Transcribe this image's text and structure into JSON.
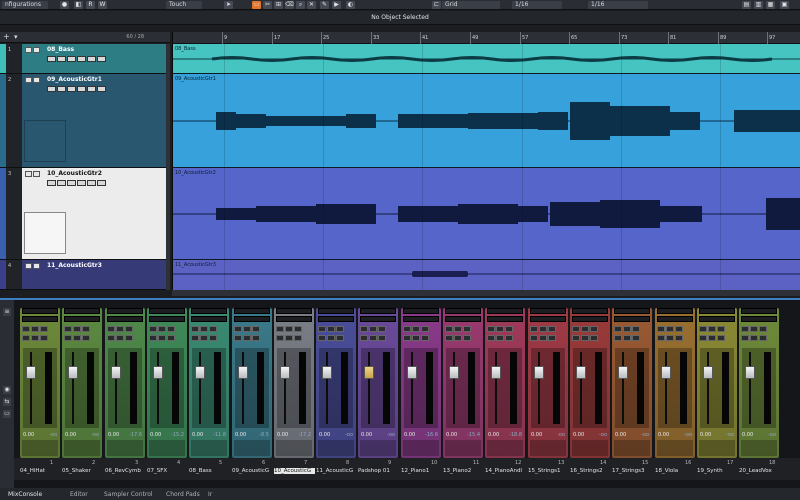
{
  "toolbar": {
    "left_label": "nfigurations",
    "mode_label": "Touch",
    "grid_label": "Grid",
    "quantize_label": "1/16",
    "selection_info": "No Object Selected"
  },
  "tracklist": {
    "count_label": "60 / 28",
    "tracks": [
      {
        "num": "1",
        "name": "08_Bass",
        "color": "#3fbfb8",
        "bg": "#2f7f86"
      },
      {
        "num": "2",
        "name": "09_AcousticGtr1",
        "color": "#2a6a8a",
        "bg": "#2b5b78"
      },
      {
        "num": "3",
        "name": "10_AcousticGtr2",
        "color": "#e8e8e8",
        "bg": "#e9e9e9"
      },
      {
        "num": "4",
        "name": "11_AcousticGtr3",
        "color": "#3b3f8a",
        "bg": "#3a3c7a"
      }
    ]
  },
  "ruler": {
    "ticks": [
      "9",
      "17",
      "25",
      "33",
      "41",
      "49",
      "57",
      "65",
      "73",
      "81",
      "89",
      "97"
    ]
  },
  "arrange": {
    "events": [
      {
        "label": "08_Bass",
        "color": "#45c4c2"
      },
      {
        "label": "09_AcousticGtr1",
        "color": "#35a0da"
      },
      {
        "label": "10_AcousticGtr2",
        "color": "#5566c8"
      },
      {
        "label": "11_AcousticGtr3",
        "color": "#5a60c2"
      }
    ]
  },
  "mixer": {
    "channels": [
      {
        "num": "1",
        "name": "04_HiHat",
        "color": "#6d8a3a",
        "val": "0.00",
        "peak": "-oo"
      },
      {
        "num": "2",
        "name": "05_Shaker",
        "color": "#5c8a40",
        "val": "0.00",
        "peak": "-oo"
      },
      {
        "num": "3",
        "name": "06_RevCymb",
        "color": "#4f8a4a",
        "val": "0.00",
        "peak": "-17.6"
      },
      {
        "num": "4",
        "name": "07_SFX",
        "color": "#3f8a58",
        "val": "0.00",
        "peak": "-15.2"
      },
      {
        "num": "5",
        "name": "08_Bass",
        "color": "#3a8a72",
        "val": "0.00",
        "peak": "-11.8"
      },
      {
        "num": "6",
        "name": "09_AcousticG",
        "color": "#3a7a8a",
        "val": "0.00",
        "peak": "-8.5"
      },
      {
        "num": "7",
        "name": "10_AcousticG",
        "color": "#7a7e86",
        "val": "0.00",
        "peak": "-17.2"
      },
      {
        "num": "8",
        "name": "11_AcousticG",
        "color": "#4a4e9a",
        "val": "0.00",
        "peak": "-oo"
      },
      {
        "num": "9",
        "name": "Padshop 01",
        "color": "#6a4a9a",
        "val": "0.00",
        "peak": "-oo"
      },
      {
        "num": "10",
        "name": "12_Piano1",
        "color": "#8a3a8a",
        "val": "0.00",
        "peak": "-16.6"
      },
      {
        "num": "11",
        "name": "13_Piano2",
        "color": "#9a3a70",
        "val": "0.00",
        "peak": "-15.4"
      },
      {
        "num": "12",
        "name": "14_PianoAndI",
        "color": "#a03a5a",
        "val": "0.00",
        "peak": "-18.8"
      },
      {
        "num": "13",
        "name": "15_Strings1",
        "color": "#a03a46",
        "val": "0.00",
        "peak": "-oo"
      },
      {
        "num": "14",
        "name": "16_Strings2",
        "color": "#9a3a3a",
        "val": "0.00",
        "peak": "-oo"
      },
      {
        "num": "15",
        "name": "17_Strings3",
        "color": "#9a5a32",
        "val": "0.00",
        "peak": "-oo"
      },
      {
        "num": "16",
        "name": "18_Viola",
        "color": "#9a7030",
        "val": "0.00",
        "peak": "-oo"
      },
      {
        "num": "17",
        "name": "19_Synth",
        "color": "#8a8a34",
        "val": "0.00",
        "peak": "-oo"
      },
      {
        "num": "18",
        "name": "20_LeadVox",
        "color": "#6e8a3a",
        "val": "0.00",
        "peak": "-oo"
      }
    ]
  },
  "mixer_tabs": [
    "MixConsole",
    "Editor",
    "Sampler Control",
    "Chord Pads",
    "Ir"
  ]
}
